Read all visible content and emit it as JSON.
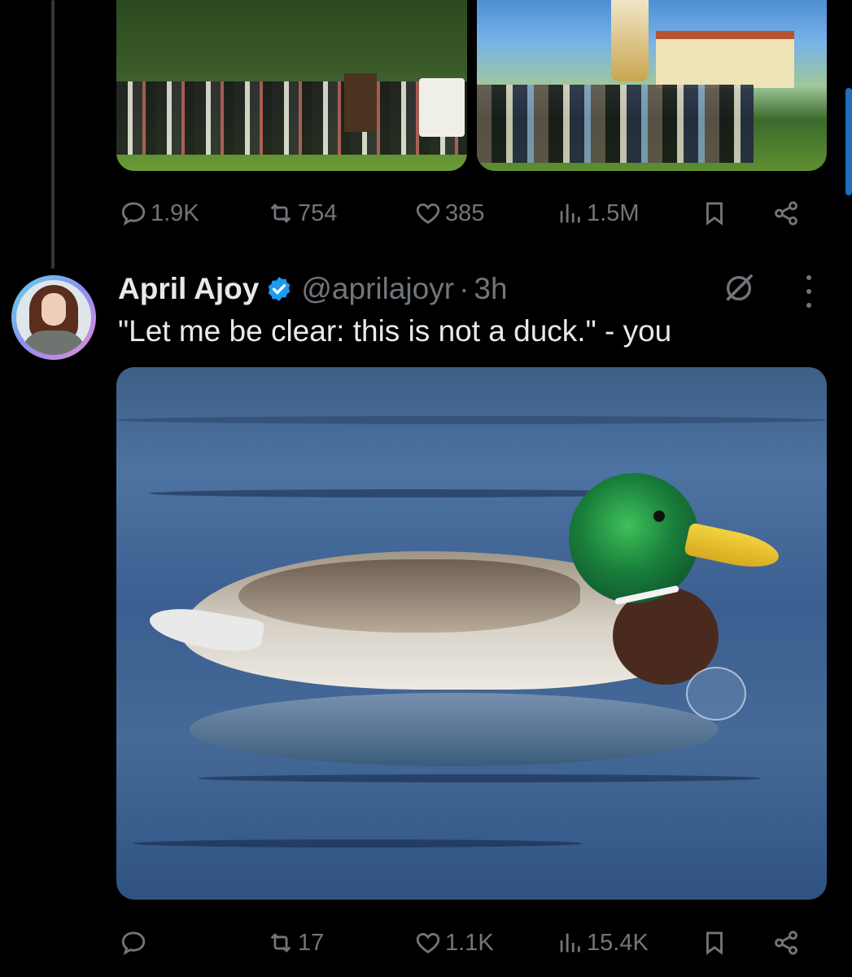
{
  "prev_tweet": {
    "stats": {
      "replies": "1.9K",
      "reposts": "754",
      "likes": "385",
      "views": "1.5M"
    }
  },
  "tweet": {
    "author_name": "April Ajoy",
    "handle": "@aprilajoyr",
    "separator": "·",
    "age": "3h",
    "text": "\"Let me be clear: this is not a duck.\" - you",
    "stats": {
      "replies": "",
      "reposts": "17",
      "likes": "1.1K",
      "views": "15.4K"
    }
  },
  "icons": {
    "reply": "speech-bubble-icon",
    "repost": "repost-arrows-icon",
    "like": "heart-icon",
    "views": "bar-chart-icon",
    "bookmark": "bookmark-icon",
    "share": "share-nodes-icon",
    "verified": "verified-badge-icon",
    "grok": "grok-slash-icon",
    "more": "vertical-ellipsis-icon"
  },
  "colors": {
    "background": "#000000",
    "text_primary": "#e7e9ea",
    "text_secondary": "#71767b",
    "verified_blue": "#1d9bf0"
  }
}
